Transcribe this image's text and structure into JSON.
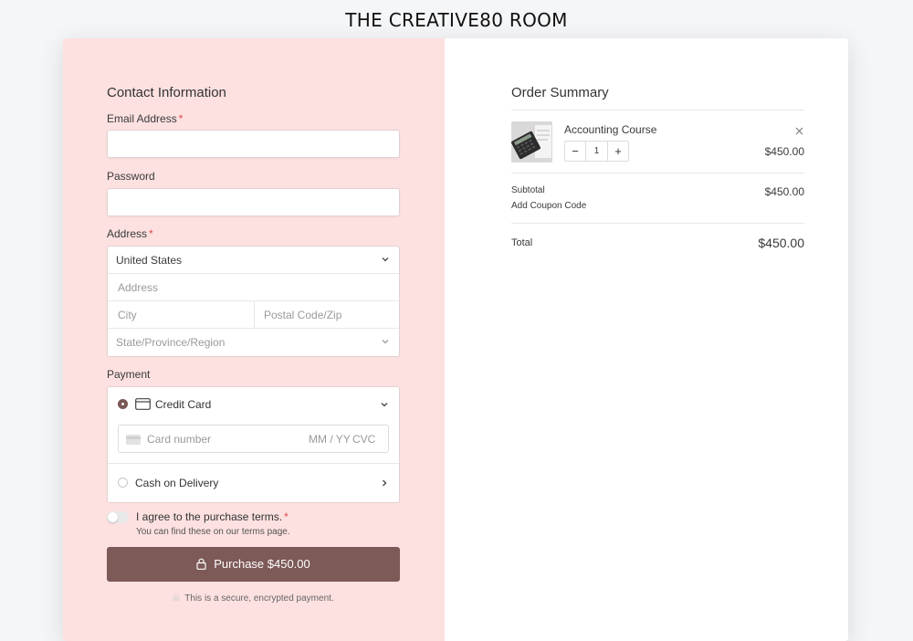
{
  "brand": "THE CREATIVE80 ROOM",
  "contact": {
    "title": "Contact Information",
    "email_label": "Email Address",
    "required_mark": "*",
    "password_label": "Password",
    "address_label": "Address",
    "country": "United States",
    "address_placeholder": "Address",
    "city_placeholder": "City",
    "postal_placeholder": "Postal Code/Zip",
    "state_placeholder": "State/Province/Region"
  },
  "payment": {
    "title": "Payment",
    "credit_card_label": "Credit Card",
    "card_number_placeholder": "Card number",
    "expiry_placeholder": "MM / YY",
    "cvc_placeholder": "CVC",
    "cod_label": "Cash on Delivery",
    "selected": "Credit Card"
  },
  "terms": {
    "agree_label": "I agree to the purchase terms.",
    "hint": "You can find these on our terms page."
  },
  "purchase_button": "Purchase $450.00",
  "secure_note": "This is a secure, encrypted payment.",
  "summary": {
    "title": "Order Summary",
    "item_name": "Accounting Course",
    "quantity": "1",
    "item_price": "$450.00",
    "subtotal_label": "Subtotal",
    "subtotal_value": "$450.00",
    "coupon_label": "Add Coupon Code",
    "total_label": "Total",
    "total_value": "$450.00"
  },
  "colors": {
    "left_bg": "#fde0e0",
    "accent": "#7d5957",
    "required": "#e04848"
  }
}
